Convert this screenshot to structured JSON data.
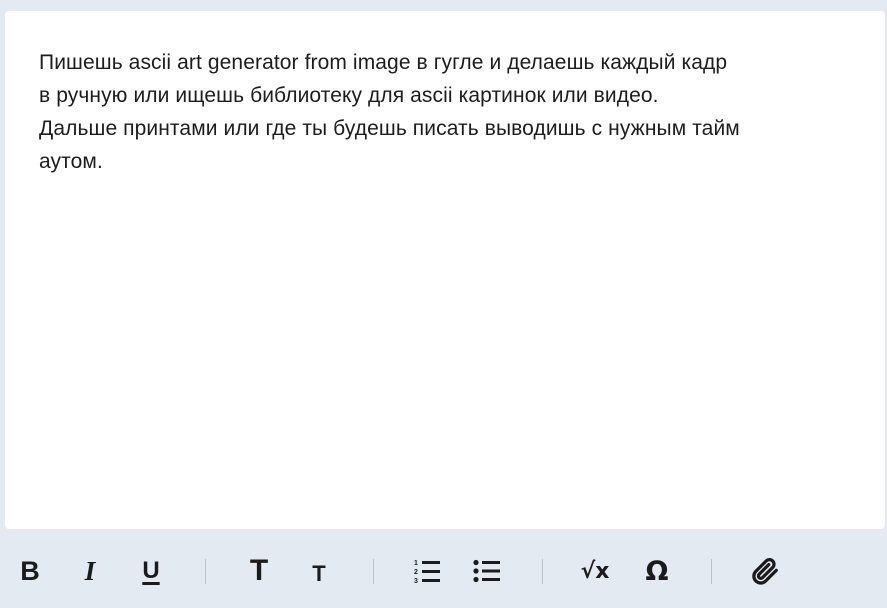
{
  "editor": {
    "text": "Пишешь ascii art generator from image в гугле и делаешь каждый кадр\nв ручную или ищешь библиотеку для ascii картинок или видео.\nДальше принтами или где ты будешь писать выводишь с нужным тайм\nаутом."
  },
  "toolbar": {
    "bold_glyph": "B",
    "italic_glyph": "I",
    "underline_glyph": "U",
    "heading_large_glyph": "T",
    "heading_small_glyph": "T",
    "sqrt_glyph": "√x",
    "omega_glyph": "Ω",
    "icons": {
      "ordered_list": "ordered-list-icon",
      "unordered_list": "unordered-list-icon",
      "attachment": "paperclip-icon"
    }
  },
  "colors": {
    "background": "#e4eaf1",
    "card": "#ffffff",
    "text": "#1d1d1d",
    "separator": "#b9c4cf"
  }
}
